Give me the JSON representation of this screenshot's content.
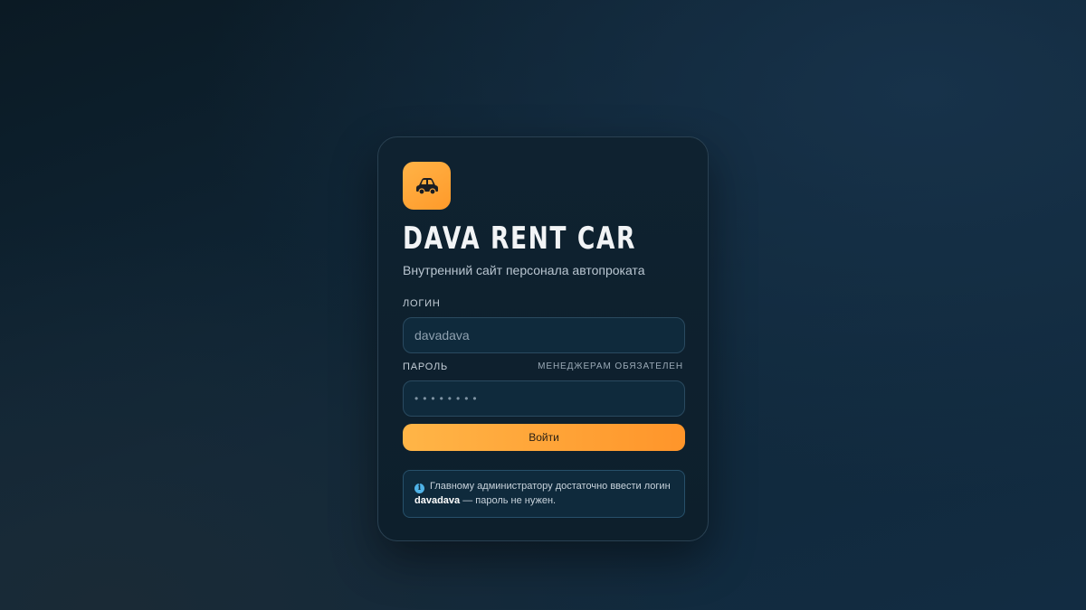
{
  "brand": {
    "title": "DAVA RENT CAR",
    "subtitle": "Внутренний сайт персонала автопроката",
    "logo_icon": "car-icon",
    "accent": "#ff9f2e"
  },
  "form": {
    "login_label": "ЛОГИН",
    "login_value": "davadava",
    "password_label": "ПАРОЛЬ",
    "password_hint": "МЕНЕДЖЕРАМ ОБЯЗАТЕЛЕН",
    "password_value": "••••••••",
    "submit_label": "Войти"
  },
  "notice": {
    "icon": "info-icon",
    "text_before": "Главному администратору достаточно ввести логин ",
    "highlight": "davadava",
    "text_after": " — пароль не нужен."
  }
}
